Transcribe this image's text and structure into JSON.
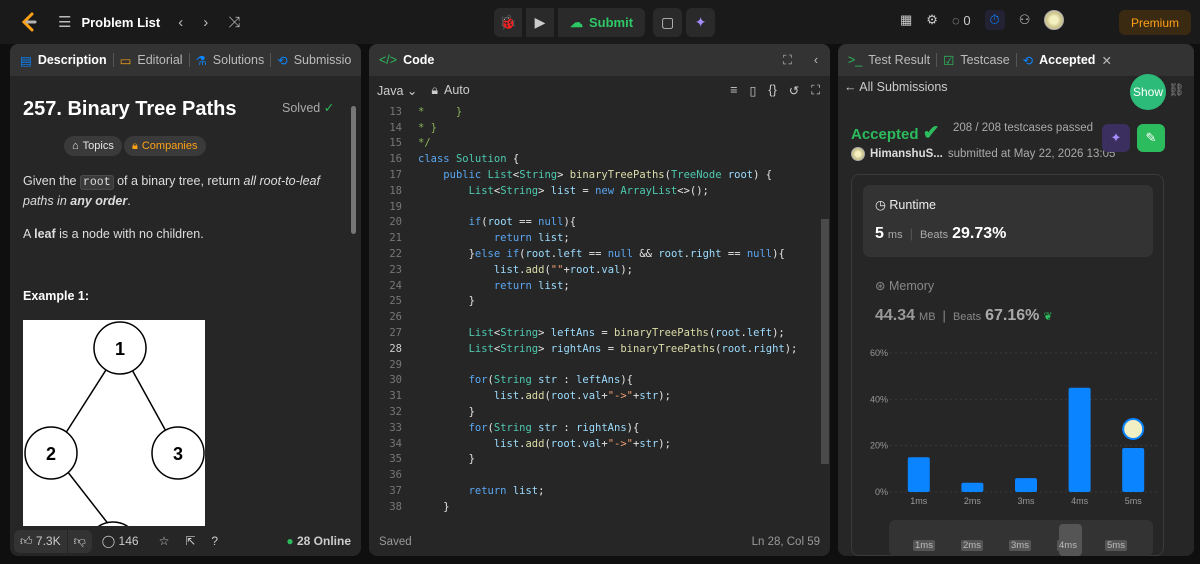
{
  "topbar": {
    "title": "Problem List",
    "submit": "Submit",
    "streak": "0",
    "premium": "Premium"
  },
  "left": {
    "tabs": [
      "Description",
      "Editorial",
      "Solutions",
      "Submissio"
    ],
    "title": "257. Binary Tree Paths",
    "solved": "Solved",
    "chips": [
      "Topics",
      "Companies"
    ],
    "para1_a": "Given the ",
    "para1_code": "root",
    "para1_b": " of a binary tree, return ",
    "para1_i": "all root-to-leaf paths in ",
    "para1_bi": "any order",
    ".": ".",
    "para1_end": ".",
    "para2_b": "leaf",
    "para2_rest": " is a node with no children.",
    "para2_a": "A ",
    "example": "Example 1:",
    "nodes": [
      "1",
      "2",
      "3"
    ],
    "likes": "7.3K",
    "comments": "146",
    "online": "28 Online"
  },
  "middle": {
    "tab": "Code",
    "lang": "Java",
    "auto": "Auto",
    "saved": "Saved",
    "pos": "Ln 28, Col 59"
  },
  "right": {
    "tabs": [
      "Test Result",
      "Testcase",
      "Accepted"
    ],
    "back": "All Submissions",
    "show": "Show",
    "status": "Accepted",
    "passed": "208 / 208 testcases passed",
    "user": "HimanshuS...",
    "submitted": "submitted at May 22, 2026 13:05",
    "runtime_label": "Runtime",
    "runtime": "5",
    "runtime_unit": "ms",
    "beats": "Beats",
    "runtime_beats": "29.73%",
    "memory_label": "Memory",
    "memory": "44.34",
    "memory_unit": "MB",
    "memory_beats": "67.16%",
    "colors": {
      "accent": "#2cbb5d",
      "bar": "#0a84ff"
    }
  },
  "chart_data": {
    "type": "bar",
    "categories": [
      "1ms",
      "2ms",
      "3ms",
      "4ms",
      "5ms"
    ],
    "values": [
      15,
      4,
      6,
      45,
      19
    ],
    "y_ticks": [
      "60%",
      "40%",
      "20%",
      "0%"
    ],
    "ylim": [
      0,
      60
    ],
    "slider_labels": [
      "1ms",
      "2ms",
      "3ms",
      "4ms",
      "5ms"
    ]
  }
}
